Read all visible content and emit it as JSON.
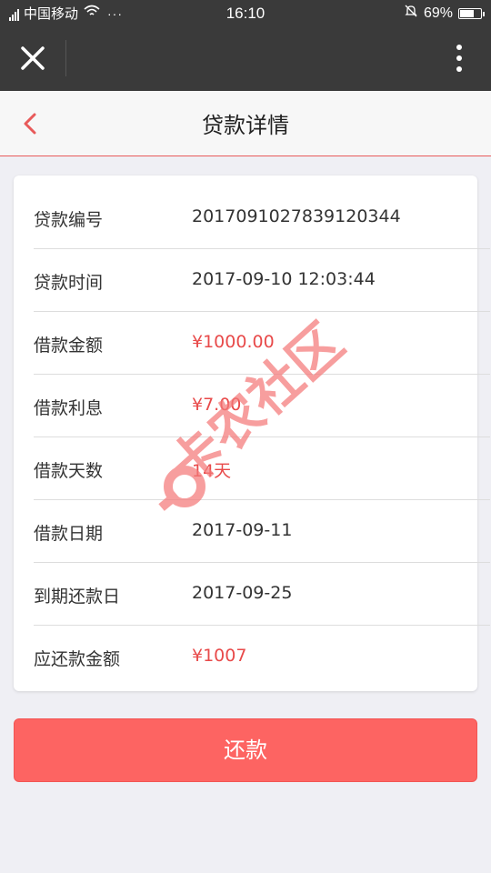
{
  "status_bar": {
    "carrier": "中国移动",
    "dots": "···",
    "time": "16:10",
    "battery_percent": "69%",
    "battery_level": 0.69
  },
  "nav": {
    "title": "贷款详情"
  },
  "details": [
    {
      "label": "贷款编号",
      "value": "2017091027839120344",
      "highlight": false
    },
    {
      "label": "贷款时间",
      "value": "2017-09-10 12:03:44",
      "highlight": false
    },
    {
      "label": "借款金额",
      "value": "¥1000.00",
      "highlight": true
    },
    {
      "label": "借款利息",
      "value": "¥7.00",
      "highlight": true
    },
    {
      "label": "借款天数",
      "value": "14天",
      "highlight": true
    },
    {
      "label": "借款日期",
      "value": "2017-09-11",
      "highlight": false
    },
    {
      "label": "到期还款日",
      "value": "2017-09-25",
      "highlight": false
    },
    {
      "label": "应还款金额",
      "value": "¥1007",
      "highlight": true
    }
  ],
  "watermark": {
    "text": "卡农社区"
  },
  "repay_button": {
    "label": "还款"
  },
  "colors": {
    "accent": "#fd6462",
    "highlight_text": "#e84a4a",
    "top_bar": "#3a3a3a"
  }
}
